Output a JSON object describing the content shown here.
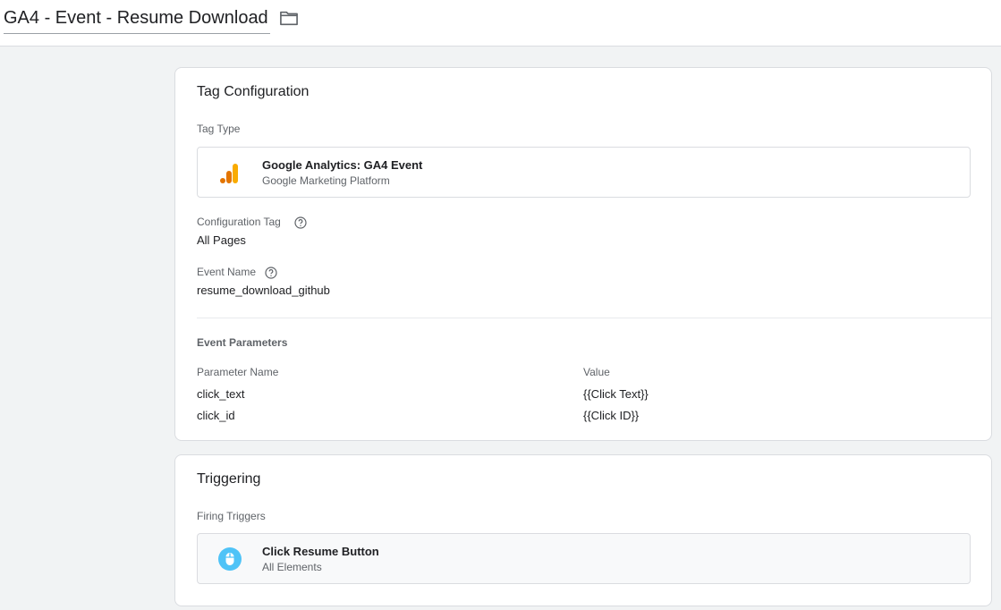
{
  "header": {
    "title": "GA4 - Event - Resume Download",
    "folder_icon": "folder-icon"
  },
  "tag_config": {
    "title": "Tag Configuration",
    "tag_type_label": "Tag Type",
    "tag_type": {
      "name": "Google Analytics: GA4 Event",
      "subtitle": "Google Marketing Platform",
      "icon": "google-analytics-icon"
    },
    "config_tag_label": "Configuration Tag",
    "config_tag_value": "All Pages",
    "event_name_label": "Event Name",
    "event_name_value": "resume_download_github",
    "event_params_label": "Event Parameters",
    "param_header_name": "Parameter Name",
    "param_header_value": "Value",
    "params": [
      {
        "name": "click_text",
        "value": "{{Click Text}}"
      },
      {
        "name": "click_id",
        "value": "{{Click ID}}"
      }
    ]
  },
  "triggering": {
    "title": "Triggering",
    "firing_triggers_label": "Firing Triggers",
    "trigger": {
      "name": "Click Resume Button",
      "subtitle": "All Elements",
      "icon": "mouse-click-icon"
    }
  },
  "colors": {
    "background": "#f1f3f4",
    "ga_orange": "#f9ab00",
    "ga_dark_orange": "#e37400",
    "trigger_blue": "#4fc3f7"
  }
}
